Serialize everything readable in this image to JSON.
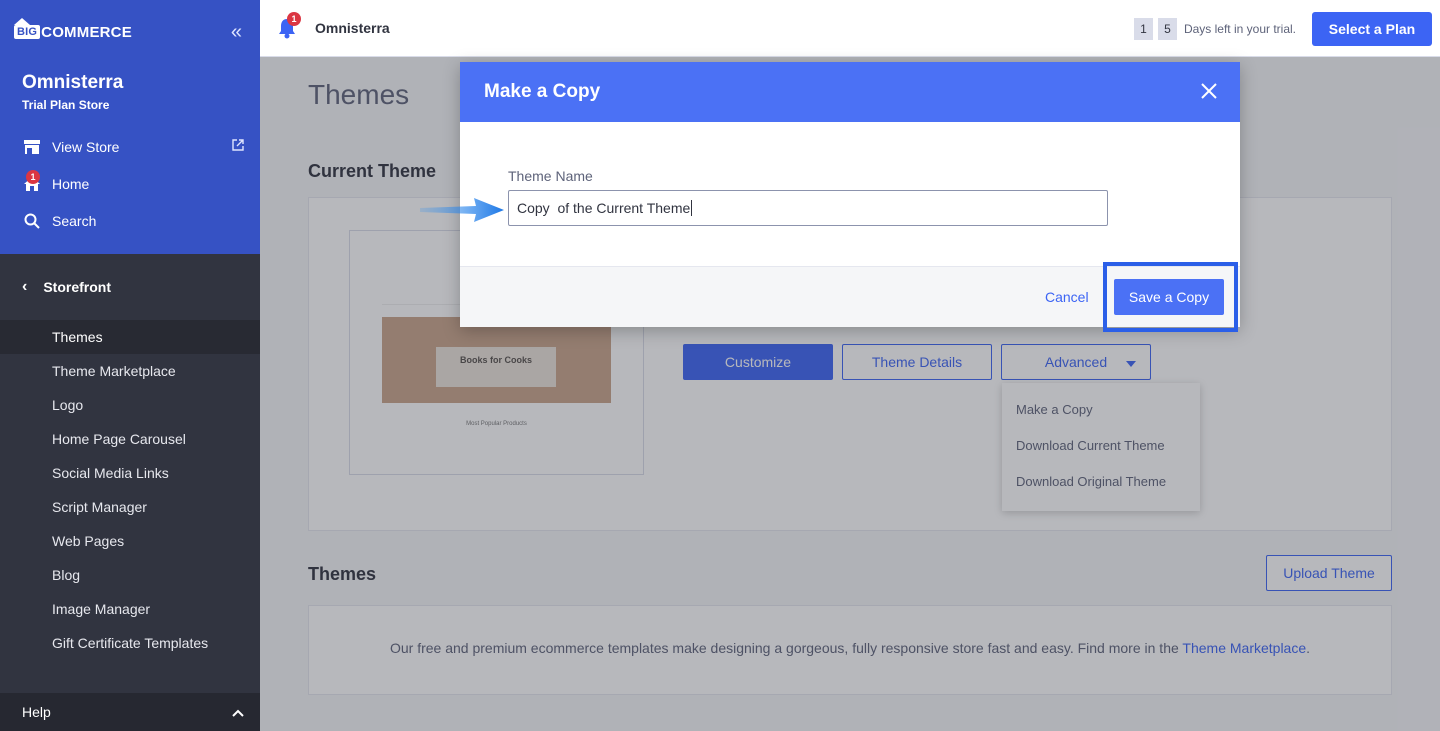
{
  "sidebar": {
    "brand": {
      "big": "BIG",
      "rest": "COMMERCE"
    },
    "collapse_icon": "double-chevron-left-icon",
    "store_name": "Omnisterra",
    "store_plan": "Trial Plan Store",
    "links": [
      {
        "label": "View Store",
        "icon": "store-icon"
      },
      {
        "label": "Home",
        "icon": "home-icon",
        "badge": "1"
      },
      {
        "label": "Search",
        "icon": "search-icon"
      }
    ],
    "section": "Storefront",
    "items": [
      {
        "label": "Themes",
        "active": true
      },
      {
        "label": "Theme Marketplace"
      },
      {
        "label": "Logo"
      },
      {
        "label": "Home Page Carousel"
      },
      {
        "label": "Social Media Links"
      },
      {
        "label": "Script Manager"
      },
      {
        "label": "Web Pages"
      },
      {
        "label": "Blog"
      },
      {
        "label": "Image Manager"
      },
      {
        "label": "Gift Certificate Templates"
      }
    ],
    "help": "Help"
  },
  "topbar": {
    "notification_badge": "1",
    "store_name": "Omnisterra",
    "trial_digits": [
      "1",
      "5"
    ],
    "trial_text": "Days left in your trial.",
    "plan_button": "Select a Plan"
  },
  "main": {
    "title": "Themes",
    "current_theme_heading": "Current Theme",
    "preview": {
      "hero_title": "Books for Cooks",
      "caption": "Most Popular Products"
    },
    "buttons": {
      "customize": "Customize",
      "details": "Theme Details",
      "advanced": "Advanced"
    },
    "advanced_menu": [
      "Make a Copy",
      "Download Current Theme",
      "Download Original Theme"
    ],
    "themes_heading": "Themes",
    "upload_button": "Upload Theme",
    "themes_text": "Our free and premium ecommerce templates make designing a gorgeous, fully responsive store fast and easy. Find more in the ",
    "themes_link": "Theme Marketplace",
    "themes_text_end": "."
  },
  "modal": {
    "title": "Make a Copy",
    "field_label": "Theme Name",
    "field_value": "Copy  of the Current Theme",
    "cancel": "Cancel",
    "save": "Save a Copy"
  }
}
